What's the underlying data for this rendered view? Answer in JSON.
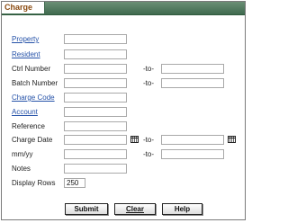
{
  "tab": {
    "title": "Charge"
  },
  "form": {
    "property_label": "Property",
    "resident_label": "Resident",
    "ctrl_number_label": "Ctrl Number",
    "batch_number_label": "Batch Number",
    "charge_code_label": "Charge Code",
    "account_label": "Account",
    "reference_label": "Reference",
    "charge_date_label": "Charge Date",
    "mmyy_label": "mm/yy",
    "notes_label": "Notes",
    "display_rows_label": "Display Rows",
    "to_label": "-to-",
    "display_rows_value": "250"
  },
  "buttons": {
    "submit": "Submit",
    "clear": "Clear",
    "help": "Help"
  }
}
